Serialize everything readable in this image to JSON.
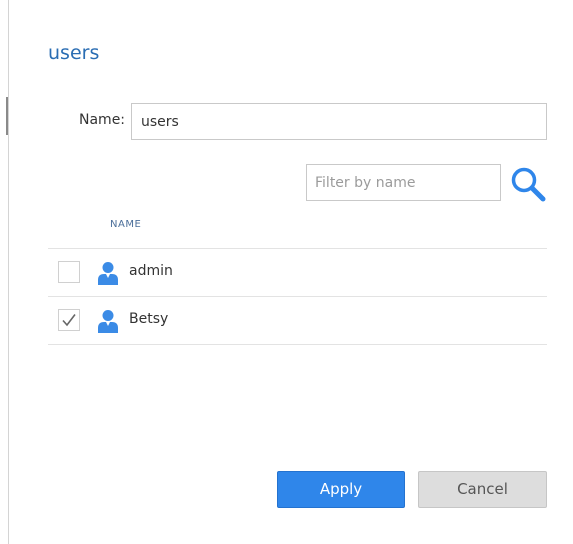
{
  "dialog": {
    "title": "users"
  },
  "name_field": {
    "label": "Name:",
    "value": "users"
  },
  "filter": {
    "placeholder": "Filter by name",
    "value": "",
    "icon": "search-icon"
  },
  "list": {
    "column_header": "NAME",
    "rows": [
      {
        "label": "admin",
        "checked": false,
        "icon": "user-icon"
      },
      {
        "label": "Betsy",
        "checked": true,
        "icon": "user-icon"
      }
    ]
  },
  "buttons": {
    "apply_label": "Apply",
    "cancel_label": "Cancel"
  },
  "colors": {
    "accent": "#2f86ea",
    "title": "#2a6db3",
    "user_icon": "#3b8be6"
  }
}
